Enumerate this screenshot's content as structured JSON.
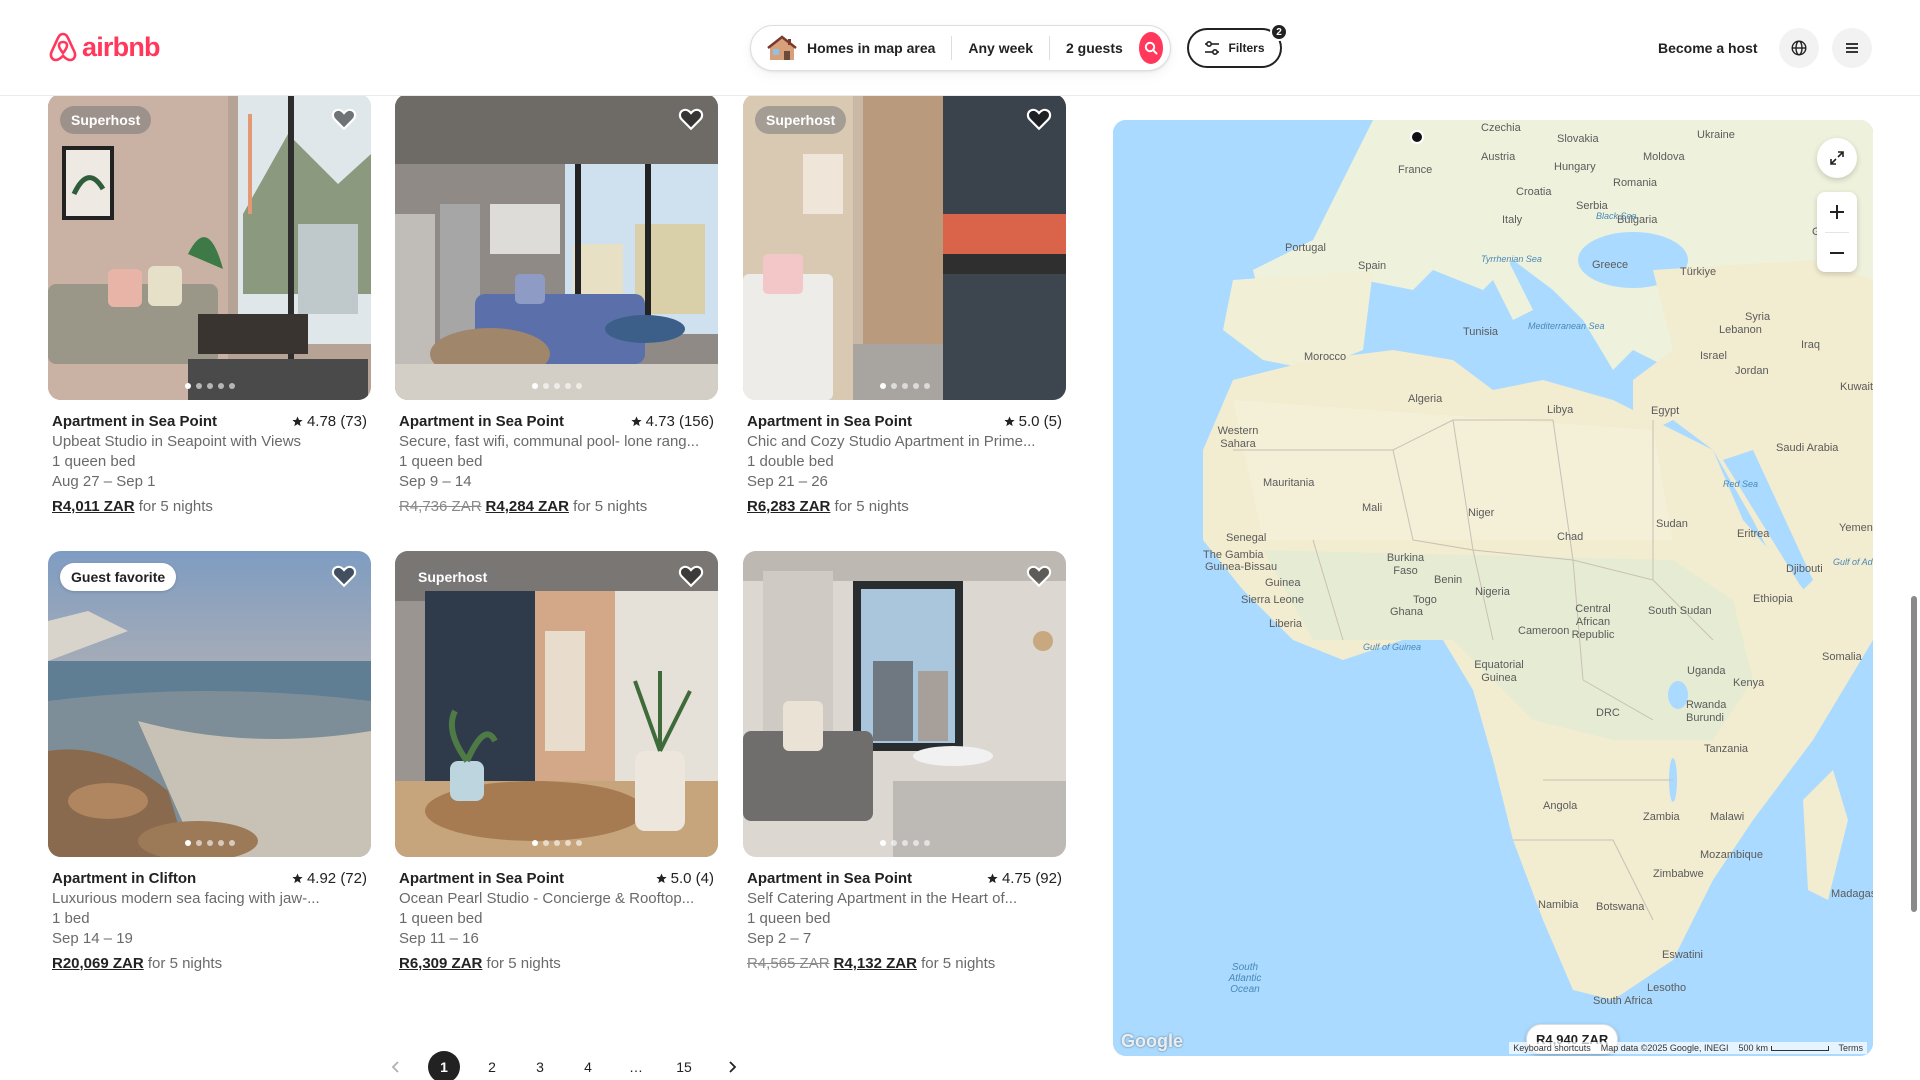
{
  "brand": {
    "name": "airbnb",
    "color": "#ff385c"
  },
  "search": {
    "location": "Homes in map area",
    "dates": "Any week",
    "guests": "2 guests"
  },
  "filters": {
    "label": "Filters",
    "count": "2"
  },
  "header": {
    "become_host": "Become a host"
  },
  "listings": [
    {
      "badge": "Superhost",
      "title": "Apartment in Sea Point",
      "rating": "4.78 (73)",
      "name": "Upbeat Studio in Seapoint with Views",
      "beds": "1 queen bed",
      "dates": "Aug 27 – Sep 1",
      "original_price": "",
      "price": "R4,011 ZAR",
      "nights": "for 5 nights"
    },
    {
      "badge": "",
      "title": "Apartment in Sea Point",
      "rating": "4.73 (156)",
      "name": "Secure, fast wifi, communal pool- lone rang...",
      "beds": "1 queen bed",
      "dates": "Sep 9 – 14",
      "original_price": "R4,736 ZAR",
      "price": "R4,284 ZAR",
      "nights": "for 5 nights"
    },
    {
      "badge": "Superhost",
      "title": "Apartment in Sea Point",
      "rating": "5.0 (5)",
      "name": "Chic and Cozy Studio Apartment in Prime...",
      "beds": "1 double bed",
      "dates": "Sep 21 – 26",
      "original_price": "",
      "price": "R6,283 ZAR",
      "nights": "for 5 nights"
    },
    {
      "badge": "Guest favorite",
      "title": "Apartment in Clifton",
      "rating": "4.92 (72)",
      "name": "Luxurious modern sea facing with jaw-...",
      "beds": "1 bed",
      "dates": "Sep 14 – 19",
      "original_price": "",
      "price": "R20,069 ZAR",
      "nights": "for 5 nights"
    },
    {
      "badge": "Superhost",
      "title": "Apartment in Sea Point",
      "rating": "5.0 (4)",
      "name": "Ocean Pearl Studio - Concierge & Rooftop...",
      "beds": "1 queen bed",
      "dates": "Sep 11 – 16",
      "original_price": "",
      "price": "R6,309 ZAR",
      "nights": "for 5 nights"
    },
    {
      "badge": "",
      "title": "Apartment in Sea Point",
      "rating": "4.75 (92)",
      "name": "Self Catering Apartment in the Heart of...",
      "beds": "1 queen bed",
      "dates": "Sep 2 – 7",
      "original_price": "R4,565 ZAR",
      "price": "R4,132 ZAR",
      "nights": "for 5 nights"
    }
  ],
  "pagination": {
    "pages": [
      "1",
      "2",
      "3",
      "4",
      "…",
      "15"
    ],
    "current": "1"
  },
  "map": {
    "price_pin": "R4,940 ZAR",
    "google": "Google",
    "footer": {
      "shortcuts": "Keyboard shortcuts",
      "data": "Map data ©2025 Google, INEGI",
      "scale": "500 km",
      "terms": "Terms"
    },
    "labels": [
      "Czechia",
      "Slovakia",
      "Ukraine",
      "Austria",
      "Hungary",
      "Moldova",
      "France",
      "Romania",
      "Croatia",
      "Serbia",
      "Italy",
      "Bulgaria",
      "Portugal",
      "Spain",
      "Greece",
      "Türkiye",
      "Geo",
      "Tunisia",
      "Syria",
      "Lebanon",
      "Iraq",
      "Israel",
      "Jordan",
      "Morocco",
      "Libya",
      "Egypt",
      "Kuwait",
      "Algeria",
      "Saudi Arabia",
      "Western Sahara",
      "Mauritania",
      "Mali",
      "Niger",
      "Sudan",
      "Eritrea",
      "Yemen",
      "Chad",
      "Senegal",
      "The Gambia",
      "Guinea-Bissau",
      "Burkina Faso",
      "Djibouti",
      "Guinea",
      "Benin",
      "Nigeria",
      "Ethiopia",
      "Sierra Leone",
      "Togo",
      "Ghana",
      "Liberia",
      "Central African Republic",
      "South Sudan",
      "Cameroon",
      "Somalia",
      "Equatorial Guinea",
      "Uganda",
      "Kenya",
      "DRC",
      "Rwanda",
      "Burundi",
      "Tanzania",
      "Angola",
      "Zambia",
      "Malawi",
      "Mozambique",
      "Zimbabwe",
      "Madagascar",
      "Namibia",
      "Botswana",
      "Eswatini",
      "Lesotho",
      "South Africa",
      "South Atlantic Ocean",
      "Black Sea",
      "Tyrrhenian Sea",
      "Mediterranean Sea",
      "Red Sea",
      "Gulf of Aden",
      "Gulf of Guinea"
    ]
  }
}
